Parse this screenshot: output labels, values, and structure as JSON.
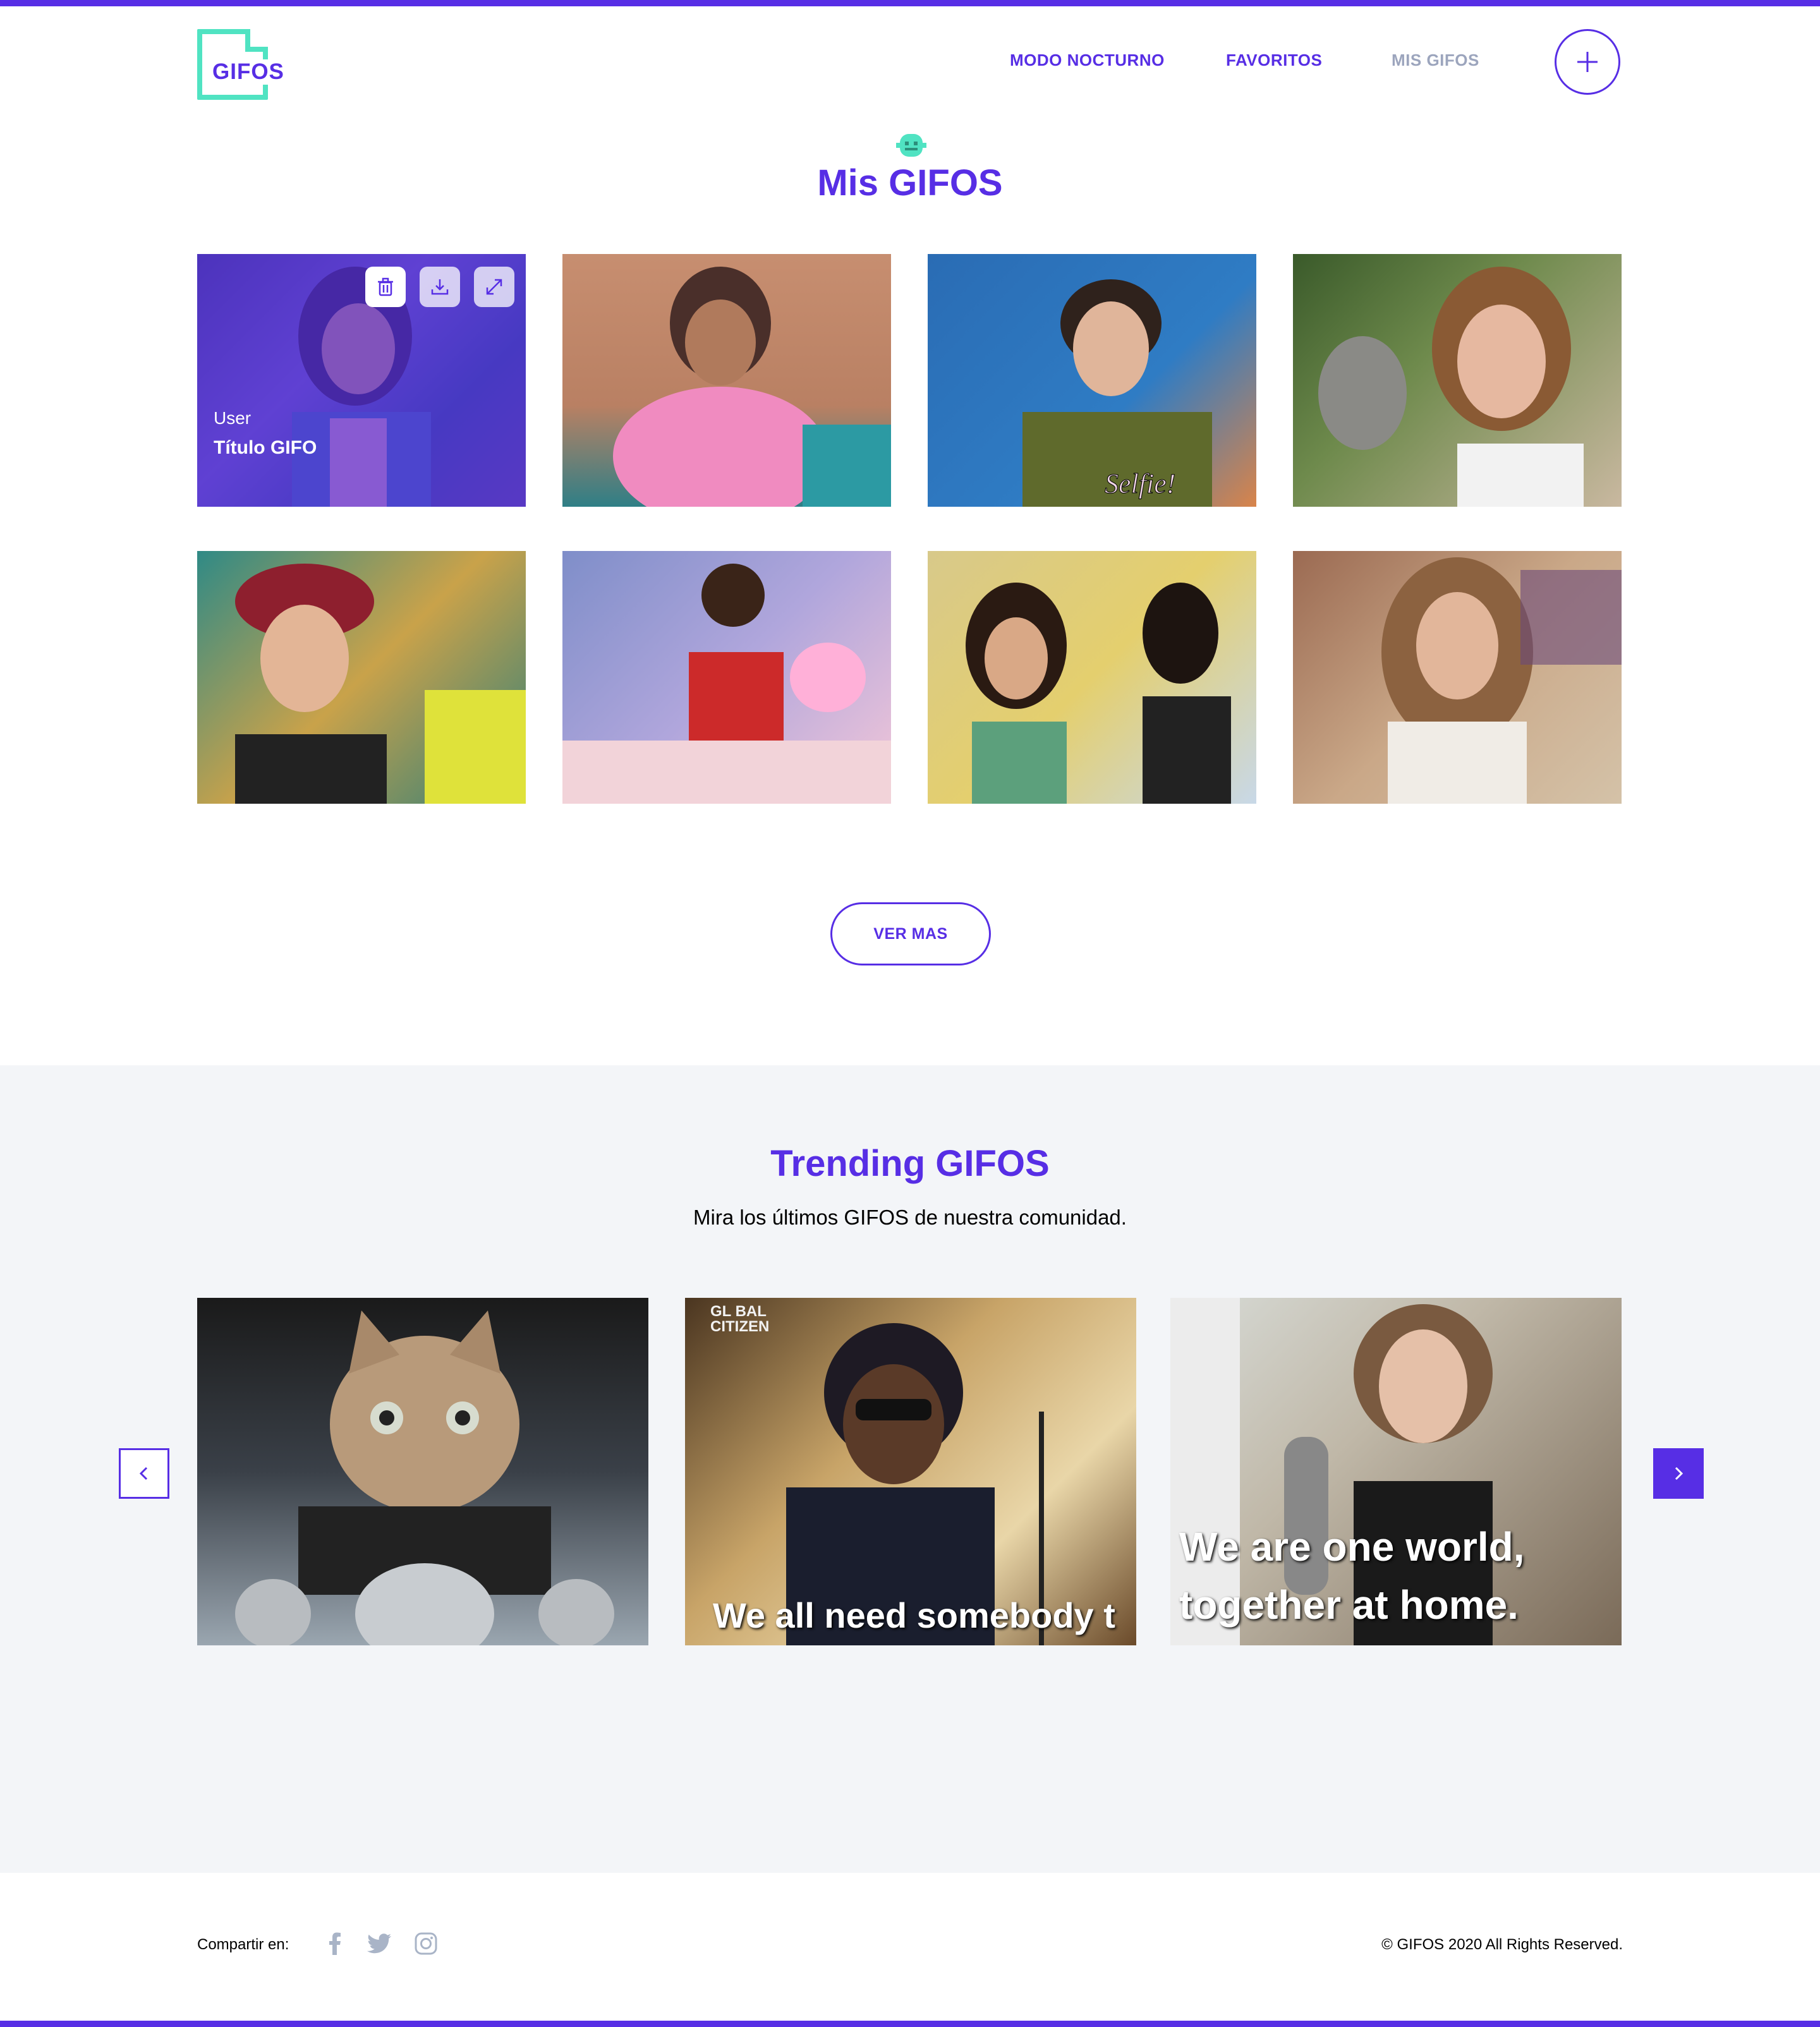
{
  "header": {
    "logo_text": "GIFOS",
    "nav": [
      {
        "label": "MODO NOCTURNO"
      },
      {
        "label": "FAVORITOS"
      },
      {
        "label": "MIS GIFOS"
      }
    ],
    "create_icon": "plus-icon"
  },
  "mis_gifos": {
    "title": "Mis GIFOS",
    "icon": "smiley-icon",
    "hover_card": {
      "user": "User",
      "title": "Título GIFO",
      "actions": [
        "trash-icon",
        "download-icon",
        "expand-icon"
      ]
    },
    "ver_mas_label": "VER MAS"
  },
  "trending": {
    "title": "Trending GIFOS",
    "subtitle": "Mira los últimos GIFOS de nuestra comunidad.",
    "cards": [
      {
        "caption": ""
      },
      {
        "caption": "We all need somebody t",
        "badge": "GL BAL\nCITIZEN"
      },
      {
        "caption": "We are one world,\ntogether at home."
      }
    ]
  },
  "footer": {
    "share_label": "Compartir en:",
    "social_icons": [
      "facebook-icon",
      "twitter-icon",
      "instagram-icon"
    ],
    "copyright": "© GIFOS 2020 All Rights Reserved."
  },
  "colors": {
    "accent": "#572ee5",
    "logo_teal": "#50e3c2",
    "nav_inactive": "#9ca5bd",
    "trending_bg": "#f3f5f8"
  }
}
